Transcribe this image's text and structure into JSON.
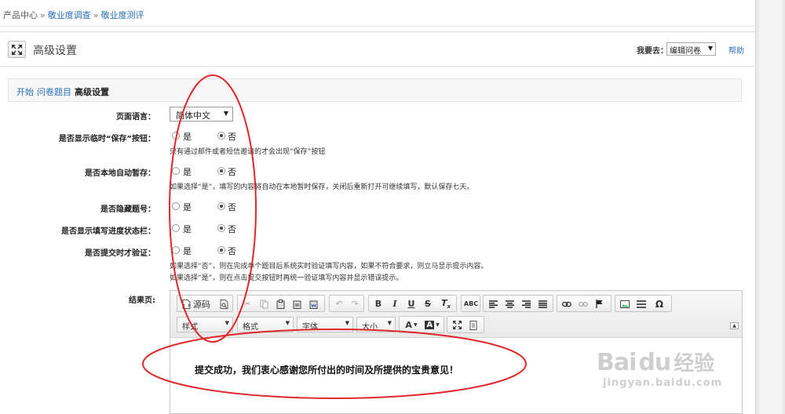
{
  "breadcrumb": {
    "root": "产品中心",
    "sep": "»",
    "level1": "敬业度调查",
    "level2": "敬业度测评"
  },
  "panel": {
    "title": "高级设置",
    "goto_label": "我要去：",
    "goto_value": "编辑问卷",
    "help": "帮助"
  },
  "tabs": {
    "start": "开始",
    "questions": "问卷题目",
    "advanced": "高级设置"
  },
  "form": {
    "lang_label": "页面语言：",
    "lang_value": "简体中文",
    "save_label": "是否显示临时“保存”按钮：",
    "save_hint": "只有通过邮件或者短信邀请的才会出现“保存”按钮",
    "autosave_label": "是否本地自动暂存：",
    "autosave_hint": "如果选择“是”，填写的内容将自动在本地暂时保存，关闭后重新打开可继续填写，默认保存七天。",
    "hide_num_label": "是否隐藏题号：",
    "progress_label": "是否显示填写进度状态栏：",
    "validate_label": "是否提交时才验证：",
    "validate_hint1": "如果选择“否”，则在完成单个题目后系统实时验证填写内容，如果不符合要求，则立马显示提示内容。",
    "validate_hint2": "如果选择“是”，则在点击提交按钮时再统一验证填写内容并显示错误提示。",
    "yes": "是",
    "no": "否",
    "result_label": "结果页:"
  },
  "editor": {
    "source": "源码",
    "style": "样式",
    "format": "格式",
    "font": "字体",
    "size": "大小",
    "text_color": "A",
    "bg_color": "A",
    "content": "提交成功，我们衷心感谢您所付出的时间及所提供的宝贵意见！"
  },
  "watermark": {
    "logo": "Bai",
    "logo2": "du",
    "cn": "经验",
    "url": "jingyan.baidu.com"
  },
  "colors": {
    "link": "#2a6fba",
    "annotation": "#e0262a"
  }
}
